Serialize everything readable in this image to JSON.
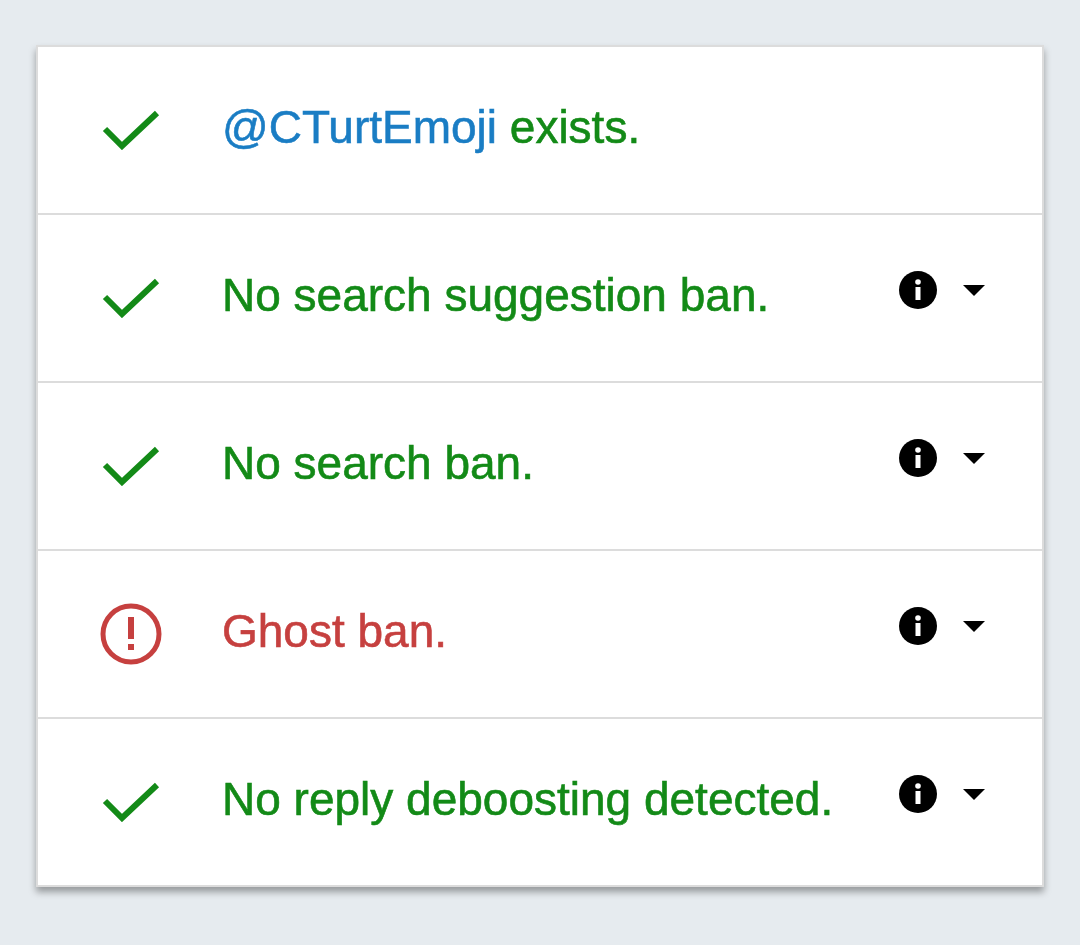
{
  "checks": [
    {
      "kind": "pass",
      "handle": "@CTurtEmoji",
      "text": "exists.",
      "info": false
    },
    {
      "kind": "pass",
      "text": "No search suggestion ban.",
      "info": true,
      "expanded": false
    },
    {
      "kind": "pass",
      "text": "No search ban.",
      "info": true,
      "expanded": false
    },
    {
      "kind": "fail",
      "text": "Ghost ban.",
      "info": true,
      "expanded": false
    },
    {
      "kind": "pass",
      "text": "No reply deboosting detected.",
      "info": true,
      "expanded": false
    }
  ]
}
